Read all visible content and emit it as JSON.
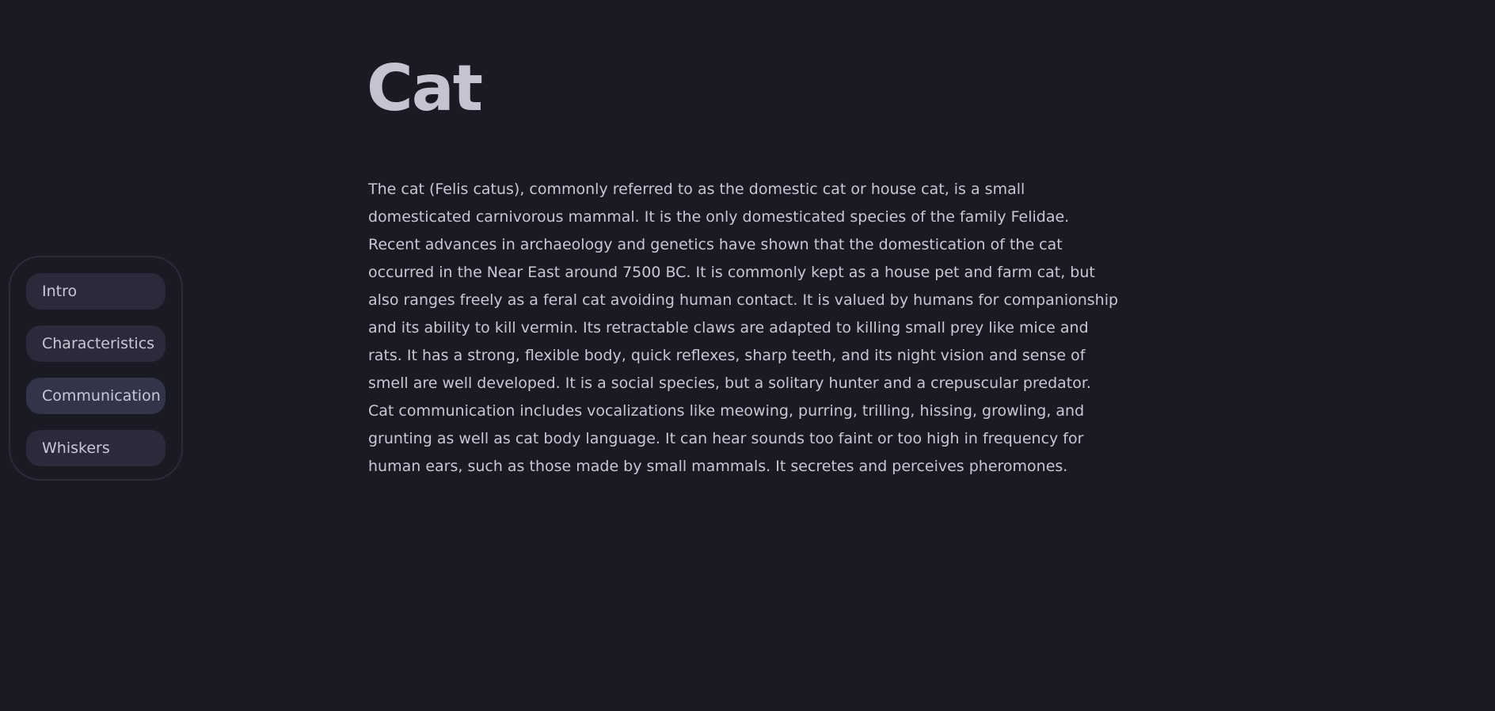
{
  "nav": {
    "items": [
      {
        "label": "Intro"
      },
      {
        "label": "Characteristics"
      },
      {
        "label": "Communication"
      },
      {
        "label": "Whiskers"
      }
    ],
    "active_index": 2
  },
  "article": {
    "title": "Cat",
    "body": "The cat (Felis catus), commonly referred to as the domestic cat or house cat, is a small domesticated carnivorous mammal. It is the only domesticated species of the family Felidae. Recent advances in archaeology and genetics have shown that the domestication of the cat occurred in the Near East around 7500 BC. It is commonly kept as a house pet and farm cat, but also ranges freely as a feral cat avoiding human contact. It is valued by humans for companionship and its ability to kill vermin. Its retractable claws are adapted to killing small prey like mice and rats. It has a strong, flexible body, quick reflexes, sharp teeth, and its night vision and sense of smell are well developed. It is a social species, but a solitary hunter and a crepuscular predator. Cat communication includes vocalizations like meowing, purring, trilling, hissing, growling, and grunting as well as cat body language. It can hear sounds too faint or too high in frequency for human ears, such as those made by small mammals. It secretes and perceives pheromones."
  },
  "colors": {
    "background": "#1a1a25",
    "nav_item": "#2a2a3a",
    "nav_item_active": "#33334a",
    "text": "#c8c8d4"
  }
}
